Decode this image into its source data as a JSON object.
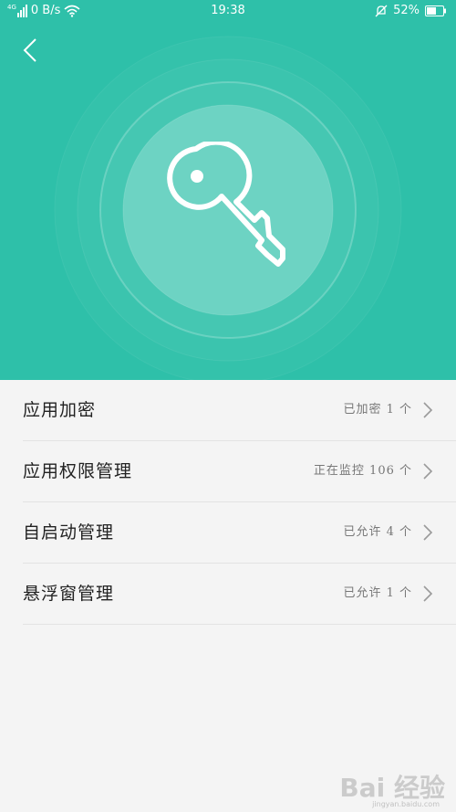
{
  "status_bar": {
    "network_label": "4G",
    "speed": "0 B/s",
    "time": "19:38",
    "battery": "52%",
    "icons": [
      "signal-icon",
      "wifi-icon",
      "silent-bell-icon",
      "battery-icon"
    ]
  },
  "header": {
    "back_icon": "chevron-left-icon",
    "hero_icon": "key-icon",
    "accent_color": "#2ec0a9"
  },
  "list": {
    "items": [
      {
        "title": "应用加密",
        "value": "已加密 1 个"
      },
      {
        "title": "应用权限管理",
        "value": "正在监控 106 个"
      },
      {
        "title": "自启动管理",
        "value": "已允许 4 个"
      },
      {
        "title": "悬浮窗管理",
        "value": "已允许 1 个"
      }
    ]
  },
  "watermark": {
    "text": "Bai 经验",
    "sub": "jingyan.baidu.com"
  }
}
